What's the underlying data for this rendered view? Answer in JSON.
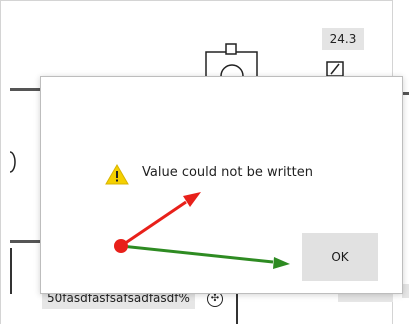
{
  "background": {
    "value_readout": "24.3",
    "tag_label": "50fasdfasfsafsadfasdf%"
  },
  "dialog": {
    "message": "Value could not be written",
    "ok_label": "OK",
    "warning_icon": "warning-triangle-icon"
  },
  "colors": {
    "warning_yellow": "#f5d000",
    "arrow_red": "#e8201a",
    "arrow_green": "#2e8b22",
    "button_gray": "#e1e1e1"
  }
}
